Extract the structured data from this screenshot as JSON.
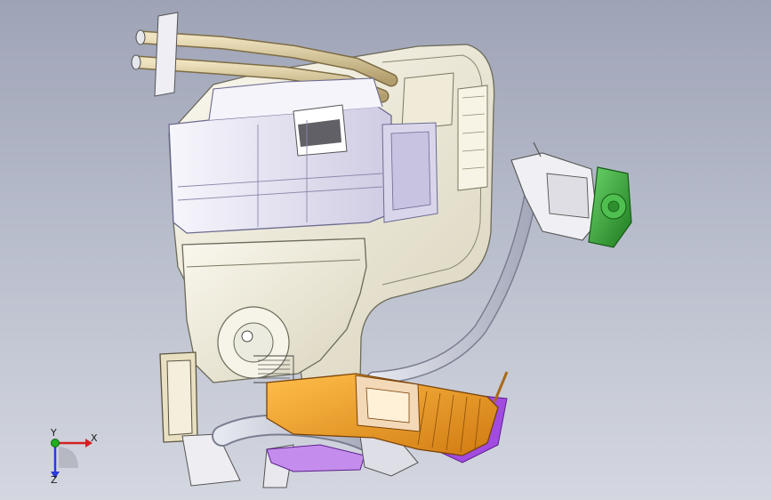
{
  "viewport": {
    "background_top": "#9ea3b6",
    "background_bottom": "#d4d7e0"
  },
  "model": {
    "components": [
      "coolant-pipes",
      "hvac-housing",
      "evaporator-case",
      "blower-scroll",
      "blower-motor-actuator",
      "drain-hose",
      "air-duct-outlet",
      "filter-frame",
      "mounting-bracket"
    ],
    "colors": {
      "housing": "#f3f0e1",
      "housing_edge": "#6c6a5a",
      "evaporator": "#ece9f6",
      "evaporator_edge": "#7878a0",
      "pipes": "#d8c9a0",
      "duct": "#f0a22a",
      "duct_shade": "#c97612",
      "purple_part": "#a24be0",
      "actuator_green": "#3aa83a",
      "hose": "#c9ccd8"
    }
  },
  "triad": {
    "x_label": "X",
    "y_label": "Y",
    "z_label": "Z",
    "x_color": "#d42020",
    "y_color": "#1fae1f",
    "z_color": "#2a3bd6"
  }
}
